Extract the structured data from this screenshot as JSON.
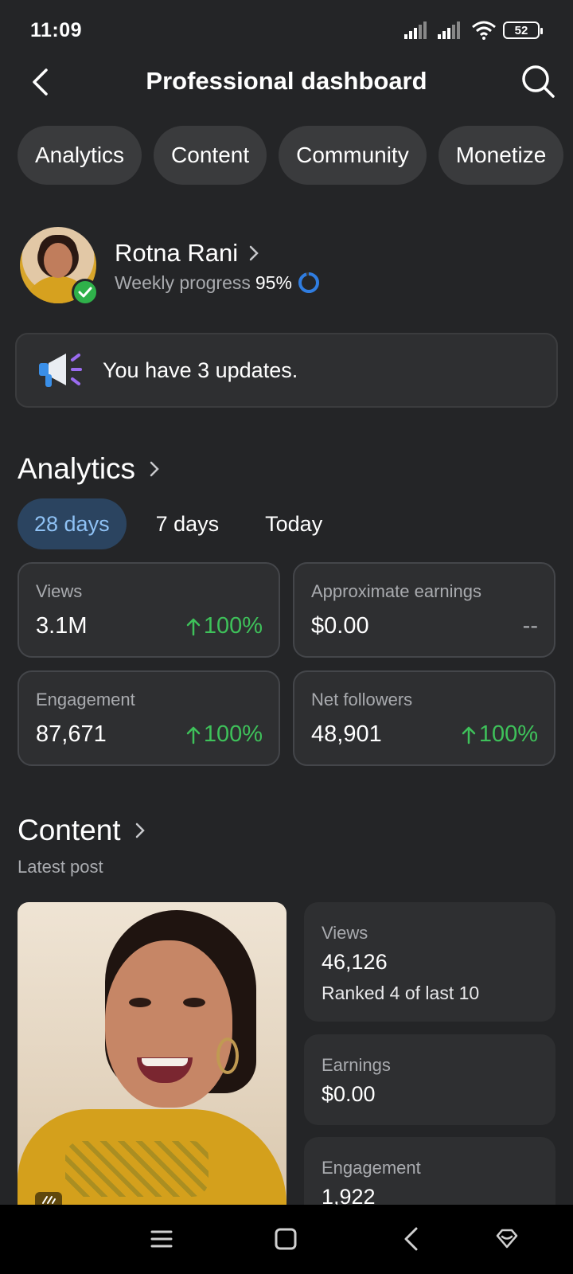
{
  "status_bar": {
    "time": "11:09",
    "battery": "52"
  },
  "header": {
    "title": "Professional dashboard"
  },
  "chips": [
    "Analytics",
    "Content",
    "Community",
    "Monetize"
  ],
  "profile": {
    "name": "Rotna Rani",
    "progress_label": "Weekly progress",
    "progress_value": "95%",
    "progress_fraction": 0.95
  },
  "updates": {
    "text": "You have 3 updates."
  },
  "analytics": {
    "title": "Analytics",
    "ranges": [
      "28 days",
      "7 days",
      "Today"
    ],
    "active_range": "28 days",
    "stats": [
      {
        "label": "Views",
        "value": "3.1M",
        "change": "100%",
        "trend": "up"
      },
      {
        "label": "Approximate earnings",
        "value": "$0.00",
        "change": "--",
        "trend": "none"
      },
      {
        "label": "Engagement",
        "value": "87,671",
        "change": "100%",
        "trend": "up"
      },
      {
        "label": "Net followers",
        "value": "48,901",
        "change": "100%",
        "trend": "up"
      }
    ]
  },
  "content": {
    "title": "Content",
    "subtitle": "Latest post",
    "metrics": [
      {
        "label": "Views",
        "value": "46,126",
        "note": "Ranked 4 of last 10"
      },
      {
        "label": "Earnings",
        "value": "$0.00"
      },
      {
        "label": "Engagement",
        "value": "1,922"
      }
    ]
  },
  "colors": {
    "background": "#242527",
    "accent_green": "#3ec15a",
    "accent_blue": "#8fc2f5",
    "verified_green": "#2fb14a"
  }
}
